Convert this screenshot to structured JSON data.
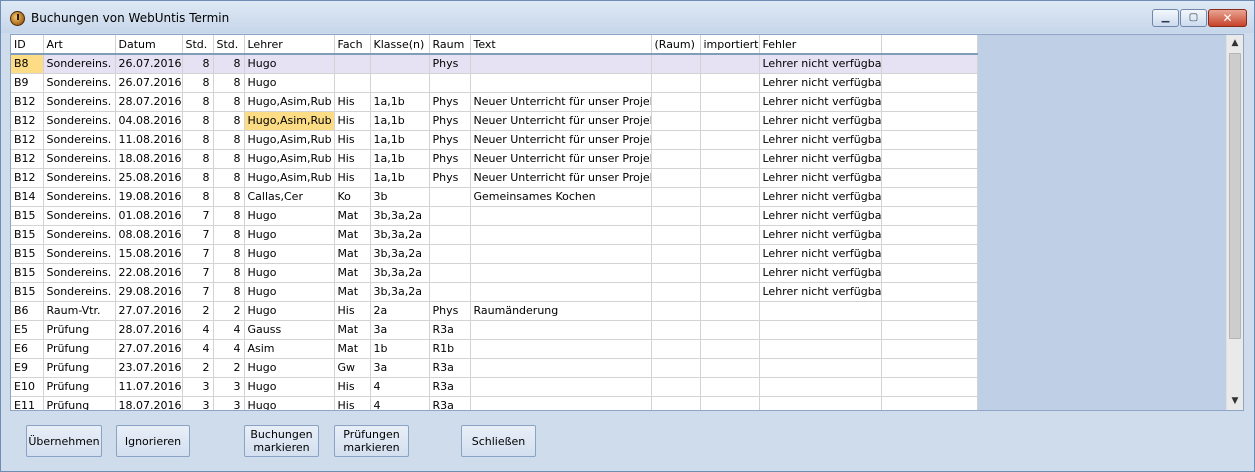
{
  "window": {
    "title": "Buchungen von WebUntis Termin",
    "close_label": "✕",
    "minimize_label": "▁",
    "maximize_label": "▢"
  },
  "columns": [
    "ID",
    "Art",
    "Datum",
    "Std.",
    "Std.",
    "Lehrer",
    "Fach",
    "Klasse(n)",
    "Raum",
    "Text",
    "(Raum)",
    "importiert",
    "Fehler",
    ""
  ],
  "rows": [
    [
      "B8",
      "Sondereins.",
      "26.07.2016",
      "8",
      "8",
      "Hugo",
      "",
      "",
      "Phys",
      "",
      "",
      "",
      "Lehrer nicht verfügbar",
      ""
    ],
    [
      "B9",
      "Sondereins.",
      "26.07.2016",
      "8",
      "8",
      "Hugo",
      "",
      "",
      "",
      "",
      "",
      "",
      "Lehrer nicht verfügbar",
      ""
    ],
    [
      "B12",
      "Sondereins.",
      "28.07.2016",
      "8",
      "8",
      "Hugo,Asim,Rub",
      "His",
      "1a,1b",
      "Phys",
      "Neuer Unterricht für unser Projekt",
      "",
      "",
      "Lehrer nicht verfügbar",
      ""
    ],
    [
      "B12",
      "Sondereins.",
      "04.08.2016",
      "8",
      "8",
      "Hugo,Asim,Rub",
      "His",
      "1a,1b",
      "Phys",
      "Neuer Unterricht für unser Projekt",
      "",
      "",
      "Lehrer nicht verfügbar",
      ""
    ],
    [
      "B12",
      "Sondereins.",
      "11.08.2016",
      "8",
      "8",
      "Hugo,Asim,Rub",
      "His",
      "1a,1b",
      "Phys",
      "Neuer Unterricht für unser Projekt",
      "",
      "",
      "Lehrer nicht verfügbar",
      ""
    ],
    [
      "B12",
      "Sondereins.",
      "18.08.2016",
      "8",
      "8",
      "Hugo,Asim,Rub",
      "His",
      "1a,1b",
      "Phys",
      "Neuer Unterricht für unser Projekt",
      "",
      "",
      "Lehrer nicht verfügbar",
      ""
    ],
    [
      "B12",
      "Sondereins.",
      "25.08.2016",
      "8",
      "8",
      "Hugo,Asim,Rub",
      "His",
      "1a,1b",
      "Phys",
      "Neuer Unterricht für unser Projekt",
      "",
      "",
      "Lehrer nicht verfügbar",
      ""
    ],
    [
      "B14",
      "Sondereins.",
      "19.08.2016",
      "8",
      "8",
      "Callas,Cer",
      "Ko",
      "3b",
      "",
      "Gemeinsames Kochen",
      "",
      "",
      "Lehrer nicht verfügbar",
      ""
    ],
    [
      "B15",
      "Sondereins.",
      "01.08.2016",
      "7",
      "8",
      "Hugo",
      "Mat",
      "3b,3a,2a",
      "",
      "",
      "",
      "",
      "Lehrer nicht verfügbar",
      ""
    ],
    [
      "B15",
      "Sondereins.",
      "08.08.2016",
      "7",
      "8",
      "Hugo",
      "Mat",
      "3b,3a,2a",
      "",
      "",
      "",
      "",
      "Lehrer nicht verfügbar",
      ""
    ],
    [
      "B15",
      "Sondereins.",
      "15.08.2016",
      "7",
      "8",
      "Hugo",
      "Mat",
      "3b,3a,2a",
      "",
      "",
      "",
      "",
      "Lehrer nicht verfügbar",
      ""
    ],
    [
      "B15",
      "Sondereins.",
      "22.08.2016",
      "7",
      "8",
      "Hugo",
      "Mat",
      "3b,3a,2a",
      "",
      "",
      "",
      "",
      "Lehrer nicht verfügbar",
      ""
    ],
    [
      "B15",
      "Sondereins.",
      "29.08.2016",
      "7",
      "8",
      "Hugo",
      "Mat",
      "3b,3a,2a",
      "",
      "",
      "",
      "",
      "Lehrer nicht verfügbar",
      ""
    ],
    [
      "B6",
      "Raum-Vtr.",
      "27.07.2016",
      "2",
      "2",
      "Hugo",
      "His",
      "2a",
      "Phys",
      "Raumänderung",
      "",
      "",
      "",
      ""
    ],
    [
      "E5",
      "Prüfung",
      "28.07.2016",
      "4",
      "4",
      "Gauss",
      "Mat",
      "3a",
      "R3a",
      "",
      "",
      "",
      "",
      ""
    ],
    [
      "E6",
      "Prüfung",
      "27.07.2016",
      "4",
      "4",
      "Asim",
      "Mat",
      "1b",
      "R1b",
      "",
      "",
      "",
      "",
      ""
    ],
    [
      "E9",
      "Prüfung",
      "23.07.2016",
      "2",
      "2",
      "Hugo",
      "Gw",
      "3a",
      "R3a",
      "",
      "",
      "",
      "",
      ""
    ],
    [
      "E10",
      "Prüfung",
      "11.07.2016",
      "3",
      "3",
      "Hugo",
      "His",
      "4",
      "R3a",
      "",
      "",
      "",
      "",
      ""
    ],
    [
      "E11",
      "Prüfung",
      "18.07.2016",
      "3",
      "3",
      "Hugo",
      "His",
      "4",
      "R3a",
      "",
      "",
      "",
      "",
      ""
    ]
  ],
  "selected_row": 0,
  "highlight_cell": {
    "row": 3,
    "col": 5
  },
  "scrollbar": {
    "up_arrow": "▲",
    "down_arrow": "▼"
  },
  "buttons": {
    "uebernehmen": "Übernehmen",
    "ignorieren": "Ignorieren",
    "buchungen_markieren": "Buchungen\nmarkieren",
    "pruefungen_markieren": "Prüfungen\nmarkieren",
    "schliessen": "Schließen"
  },
  "colors": {
    "window_bg": "#cfdcec",
    "selected_row": "#e6e2f4",
    "highlight": "#fddc86",
    "header_border": "#7f9db9"
  }
}
